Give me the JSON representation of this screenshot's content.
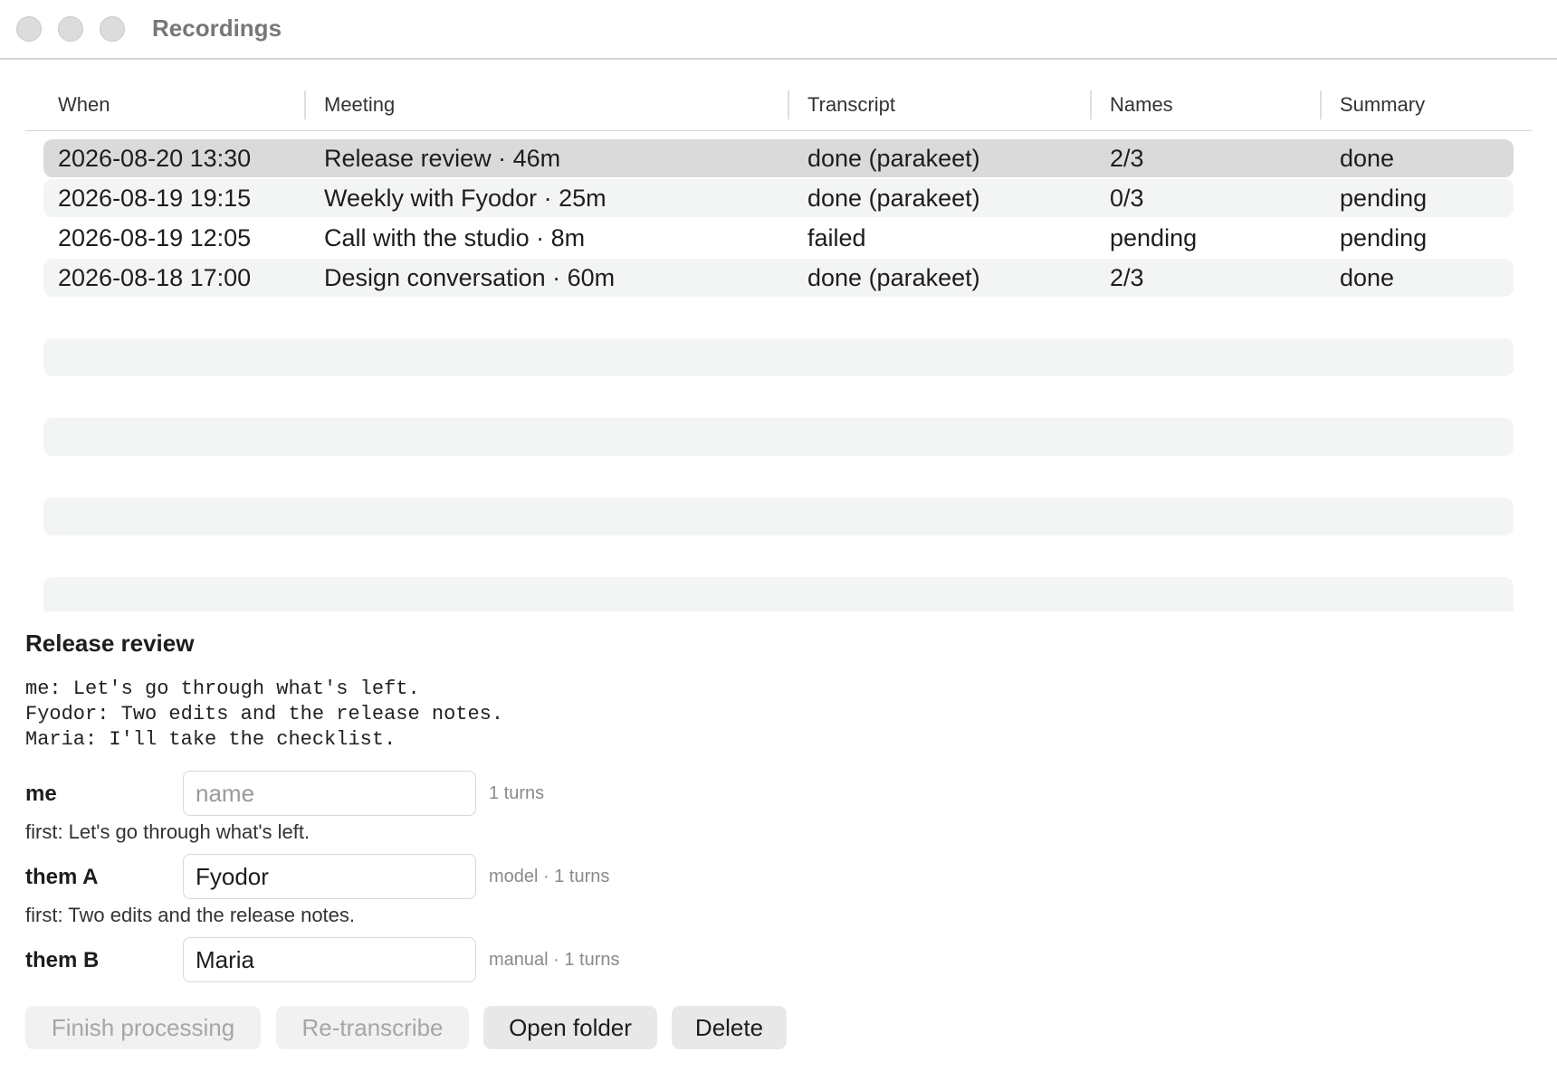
{
  "window": {
    "title": "Recordings"
  },
  "table": {
    "columns": [
      "When",
      "Meeting",
      "Transcript",
      "Names",
      "Summary"
    ],
    "rows": [
      {
        "when": "2026-08-20 13:30",
        "meeting": "Release review · 46m",
        "transcript": "done (parakeet)",
        "names": "2/3",
        "summary": "done",
        "selected": true
      },
      {
        "when": "2026-08-19 19:15",
        "meeting": "Weekly with Fyodor · 25m",
        "transcript": "done (parakeet)",
        "names": "0/3",
        "summary": "pending"
      },
      {
        "when": "2026-08-19 12:05",
        "meeting": "Call with the studio · 8m",
        "transcript": "failed",
        "names": "pending",
        "summary": "pending"
      },
      {
        "when": "2026-08-18 17:00",
        "meeting": "Design conversation · 60m",
        "transcript": "done (parakeet)",
        "names": "2/3",
        "summary": "done"
      }
    ]
  },
  "detail": {
    "title": "Release review",
    "transcript": "me: Let's go through what's left.\nFyodor: Two edits and the release notes.\nMaria: I'll take the checklist.",
    "speakers": [
      {
        "label": "me",
        "name_value": "",
        "name_placeholder": "name",
        "meta": "1 turns",
        "first": "first: Let's go through what's left."
      },
      {
        "label": "them A",
        "name_value": "Fyodor",
        "name_placeholder": "",
        "meta": "model · 1 turns",
        "first": "first: Two edits and the release notes."
      },
      {
        "label": "them B",
        "name_value": "Maria",
        "name_placeholder": "",
        "meta": "manual · 1 turns"
      }
    ]
  },
  "actions": {
    "finish_processing": "Finish processing",
    "retranscribe": "Re-transcribe",
    "open_folder": "Open folder",
    "delete": "Delete"
  }
}
